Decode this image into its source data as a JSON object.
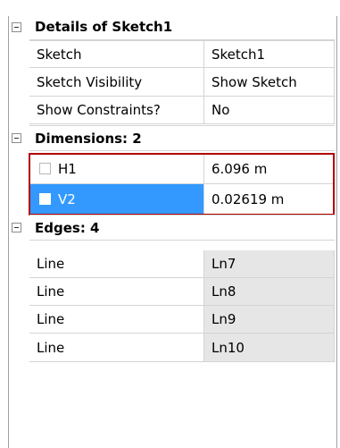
{
  "groups": {
    "details": {
      "title": "Details of Sketch1",
      "rows": [
        {
          "label": "Sketch",
          "value": "Sketch1"
        },
        {
          "label": "Sketch Visibility",
          "value": "Show Sketch"
        },
        {
          "label": "Show Constraints?",
          "value": "No"
        }
      ]
    },
    "dimensions": {
      "title": "Dimensions: 2",
      "rows": [
        {
          "label": "H1",
          "value": "6.096 m",
          "checked": false,
          "selected": false
        },
        {
          "label": "V2",
          "value": "0.02619 m",
          "checked": false,
          "selected": true
        }
      ]
    },
    "edges": {
      "title": "Edges: 4",
      "rows": [
        {
          "label": "Line",
          "value": "Ln7"
        },
        {
          "label": "Line",
          "value": "Ln8"
        },
        {
          "label": "Line",
          "value": "Ln9"
        },
        {
          "label": "Line",
          "value": "Ln10"
        }
      ]
    }
  },
  "colors": {
    "selection": "#3399ff",
    "highlight_border": "#b00000",
    "readonly_cell": "#e6e6e6"
  }
}
